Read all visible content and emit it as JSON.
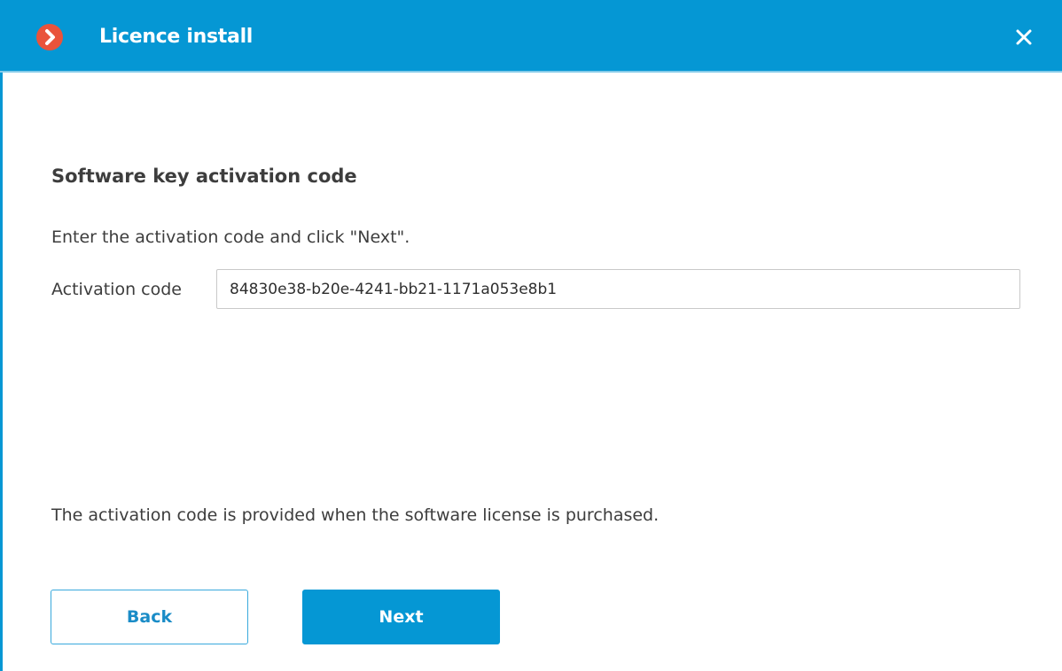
{
  "window": {
    "title": "Licence install",
    "logo_icon": "chevron-right-icon",
    "close_icon": "close-icon",
    "accent_color": "#0597d4",
    "logo_color": "#e9533b"
  },
  "content": {
    "section_title": "Software key activation code",
    "instruction": "Enter the activation code and click \"Next\".",
    "activation_label": "Activation code",
    "activation_value": "84830e38-b20e-4241-bb21-1171a053e8b1",
    "footer_note": "The activation code is provided when the software license is purchased."
  },
  "buttons": {
    "back_label": "Back",
    "next_label": "Next"
  }
}
